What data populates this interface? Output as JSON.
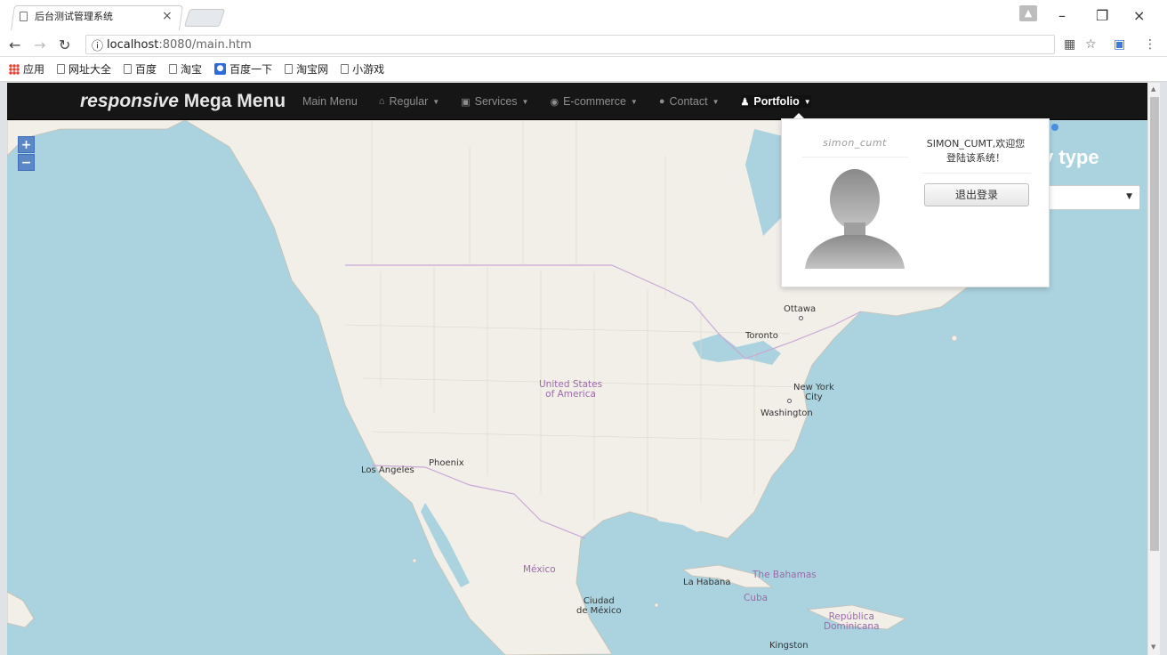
{
  "browser": {
    "tab_title": "后台测试管理系统",
    "tab_close": "×",
    "url_host": "localhost",
    "url_rest": ":8080/main.htm",
    "info_glyph": "ⓘ",
    "bookmarks": [
      {
        "label": "应用",
        "icon": "apps-icon"
      },
      {
        "label": "网址大全",
        "icon": "page-icon"
      },
      {
        "label": "百度",
        "icon": "page-icon"
      },
      {
        "label": "淘宝",
        "icon": "page-icon"
      },
      {
        "label": "百度一下",
        "icon": "baidu-icon"
      },
      {
        "label": "淘宝网",
        "icon": "page-icon"
      },
      {
        "label": "小游戏",
        "icon": "page-icon"
      }
    ]
  },
  "navbar": {
    "brand_italic": "responsive",
    "brand_rest": " Mega Menu",
    "items": [
      {
        "label": "Main Menu",
        "icon": "",
        "caret": ""
      },
      {
        "label": "Regular",
        "icon": "home-icon",
        "caret": "▼"
      },
      {
        "label": "Services",
        "icon": "briefcase-icon",
        "caret": "▼"
      },
      {
        "label": "E-commerce",
        "icon": "info-circle-icon",
        "caret": "▼"
      },
      {
        "label": "Contact",
        "icon": "globe-icon",
        "caret": "▼"
      },
      {
        "label": "Portfolio",
        "icon": "user-icon",
        "caret": "▼"
      }
    ]
  },
  "map": {
    "zoom_in": "+",
    "zoom_out": "−",
    "type_label": "y type",
    "labels": {
      "ottawa": "Ottawa",
      "toronto": "Toronto",
      "usa_line1": "United States",
      "usa_line2": "of America",
      "newyork_line1": "New York",
      "newyork_line2": "City",
      "washington": "Washington",
      "phoenix": "Phoenix",
      "losangeles": "Los Angeles",
      "mexico": "México",
      "labahana": "La Habana",
      "bahamas": "The Bahamas",
      "cuba": "Cuba",
      "ciudad_line1": "Ciudad",
      "ciudad_line2": "de México",
      "republica_line1": "República",
      "republica_line2": "Dominicana",
      "kingston": "Kingston"
    }
  },
  "portfolio_panel": {
    "username": "simon_cumt",
    "welcome_line1": "SIMON_CUMT,欢迎您",
    "welcome_line2": "登陆该系统！",
    "logout_label": "退出登录"
  },
  "colors": {
    "navbar_bg": "#161616",
    "water": "#aad3df",
    "land": "#f2efe9",
    "zoom_button": "#5b87c7"
  }
}
